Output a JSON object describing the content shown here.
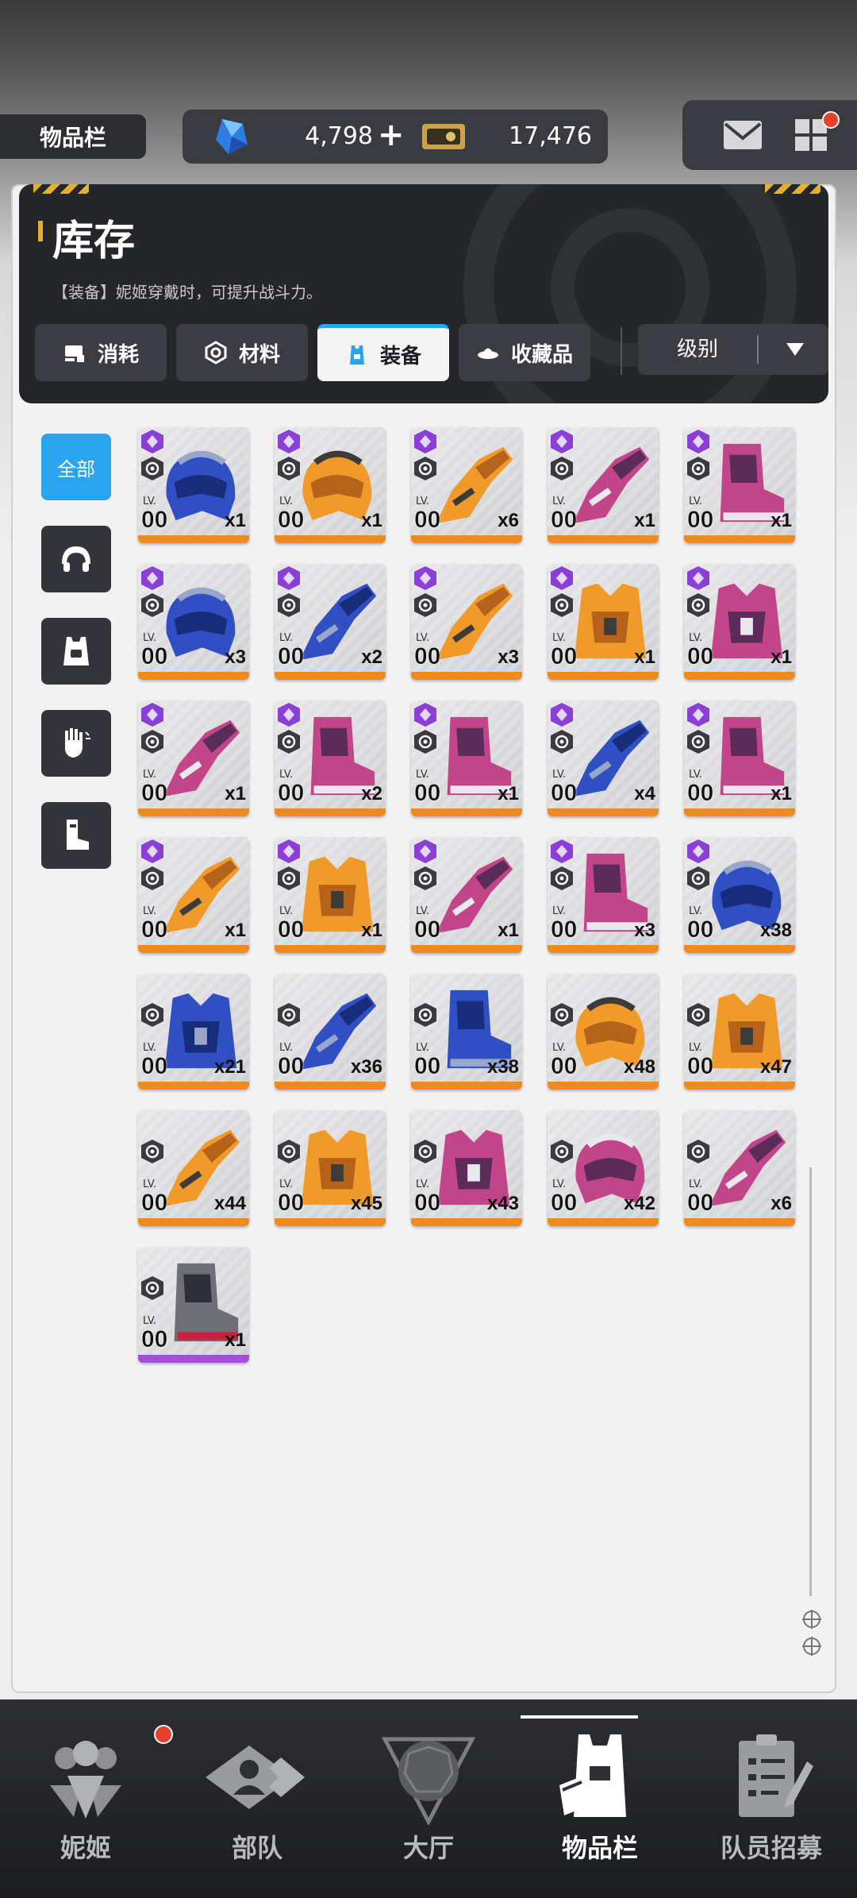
{
  "header": {
    "screen_label": "物品栏",
    "gems": "4,798",
    "gems_plus": "+",
    "coins": "17,476"
  },
  "panel": {
    "title": "库存",
    "subtitle": "【装备】妮姬穿戴时，可提升战斗力。",
    "tabs": [
      {
        "label": "消耗",
        "icon": "consumable-icon"
      },
      {
        "label": "材料",
        "icon": "material-icon"
      },
      {
        "label": "装备",
        "icon": "equipment-icon",
        "active": true
      },
      {
        "label": "收藏品",
        "icon": "collection-icon"
      }
    ],
    "sort": {
      "label": "级别"
    }
  },
  "filters": [
    {
      "label": "全部",
      "active": true
    },
    {
      "icon": "helmet-icon"
    },
    {
      "icon": "armor-icon"
    },
    {
      "icon": "glove-icon"
    },
    {
      "icon": "boot-icon"
    }
  ],
  "items_lv_label": "LV.",
  "items": [
    {
      "lv": "00",
      "qty": "x1",
      "part": "helmet",
      "color": "blue"
    },
    {
      "lv": "00",
      "qty": "x1",
      "part": "helmet",
      "color": "orange"
    },
    {
      "lv": "00",
      "qty": "x6",
      "part": "glove",
      "color": "orange"
    },
    {
      "lv": "00",
      "qty": "x1",
      "part": "glove",
      "color": "pink"
    },
    {
      "lv": "00",
      "qty": "x1",
      "part": "boot",
      "color": "pink"
    },
    {
      "lv": "00",
      "qty": "x3",
      "part": "helmet",
      "color": "blue"
    },
    {
      "lv": "00",
      "qty": "x2",
      "part": "glove",
      "color": "blue"
    },
    {
      "lv": "00",
      "qty": "x3",
      "part": "glove",
      "color": "orange"
    },
    {
      "lv": "00",
      "qty": "x1",
      "part": "armor",
      "color": "orange"
    },
    {
      "lv": "00",
      "qty": "x1",
      "part": "armor",
      "color": "pink"
    },
    {
      "lv": "00",
      "qty": "x1",
      "part": "glove",
      "color": "pink"
    },
    {
      "lv": "00",
      "qty": "x2",
      "part": "boot",
      "color": "pink"
    },
    {
      "lv": "00",
      "qty": "x1",
      "part": "boot",
      "color": "pink"
    },
    {
      "lv": "00",
      "qty": "x4",
      "part": "glove",
      "color": "blue"
    },
    {
      "lv": "00",
      "qty": "x1",
      "part": "boot",
      "color": "pink"
    },
    {
      "lv": "00",
      "qty": "x1",
      "part": "glove",
      "color": "orange"
    },
    {
      "lv": "00",
      "qty": "x1",
      "part": "armor",
      "color": "orange"
    },
    {
      "lv": "00",
      "qty": "x1",
      "part": "glove",
      "color": "pink"
    },
    {
      "lv": "00",
      "qty": "x3",
      "part": "boot",
      "color": "pink"
    },
    {
      "lv": "00",
      "qty": "x38",
      "part": "helmet",
      "color": "blue"
    },
    {
      "lv": "00",
      "qty": "x21",
      "part": "armor",
      "color": "blue"
    },
    {
      "lv": "00",
      "qty": "x36",
      "part": "glove",
      "color": "blue"
    },
    {
      "lv": "00",
      "qty": "x38",
      "part": "boot",
      "color": "blue"
    },
    {
      "lv": "00",
      "qty": "x48",
      "part": "helmet",
      "color": "orange"
    },
    {
      "lv": "00",
      "qty": "x47",
      "part": "armor",
      "color": "orange"
    },
    {
      "lv": "00",
      "qty": "x44",
      "part": "glove",
      "color": "orange"
    },
    {
      "lv": "00",
      "qty": "x45",
      "part": "armor",
      "color": "orange"
    },
    {
      "lv": "00",
      "qty": "x43",
      "part": "armor",
      "color": "pink"
    },
    {
      "lv": "00",
      "qty": "x42",
      "part": "helmet",
      "color": "pink"
    },
    {
      "lv": "00",
      "qty": "x6",
      "part": "glove",
      "color": "pink"
    },
    {
      "lv": "00",
      "qty": "x1",
      "part": "boot",
      "color": "gray",
      "rarity": "epic"
    }
  ],
  "nav": [
    {
      "label": "妮姬",
      "icon": "nikke-icon"
    },
    {
      "label": "部队",
      "icon": "squad-icon"
    },
    {
      "label": "大厅",
      "icon": "lobby-icon"
    },
    {
      "label": "物品栏",
      "icon": "inventory-icon",
      "active": true
    },
    {
      "label": "队员招募",
      "icon": "recruit-icon"
    }
  ],
  "colors": {
    "accent": "#2ba4ef",
    "rarity_orange": "#f08a1c",
    "rarity_purple": "#a64be0",
    "notification": "#e8402a"
  }
}
